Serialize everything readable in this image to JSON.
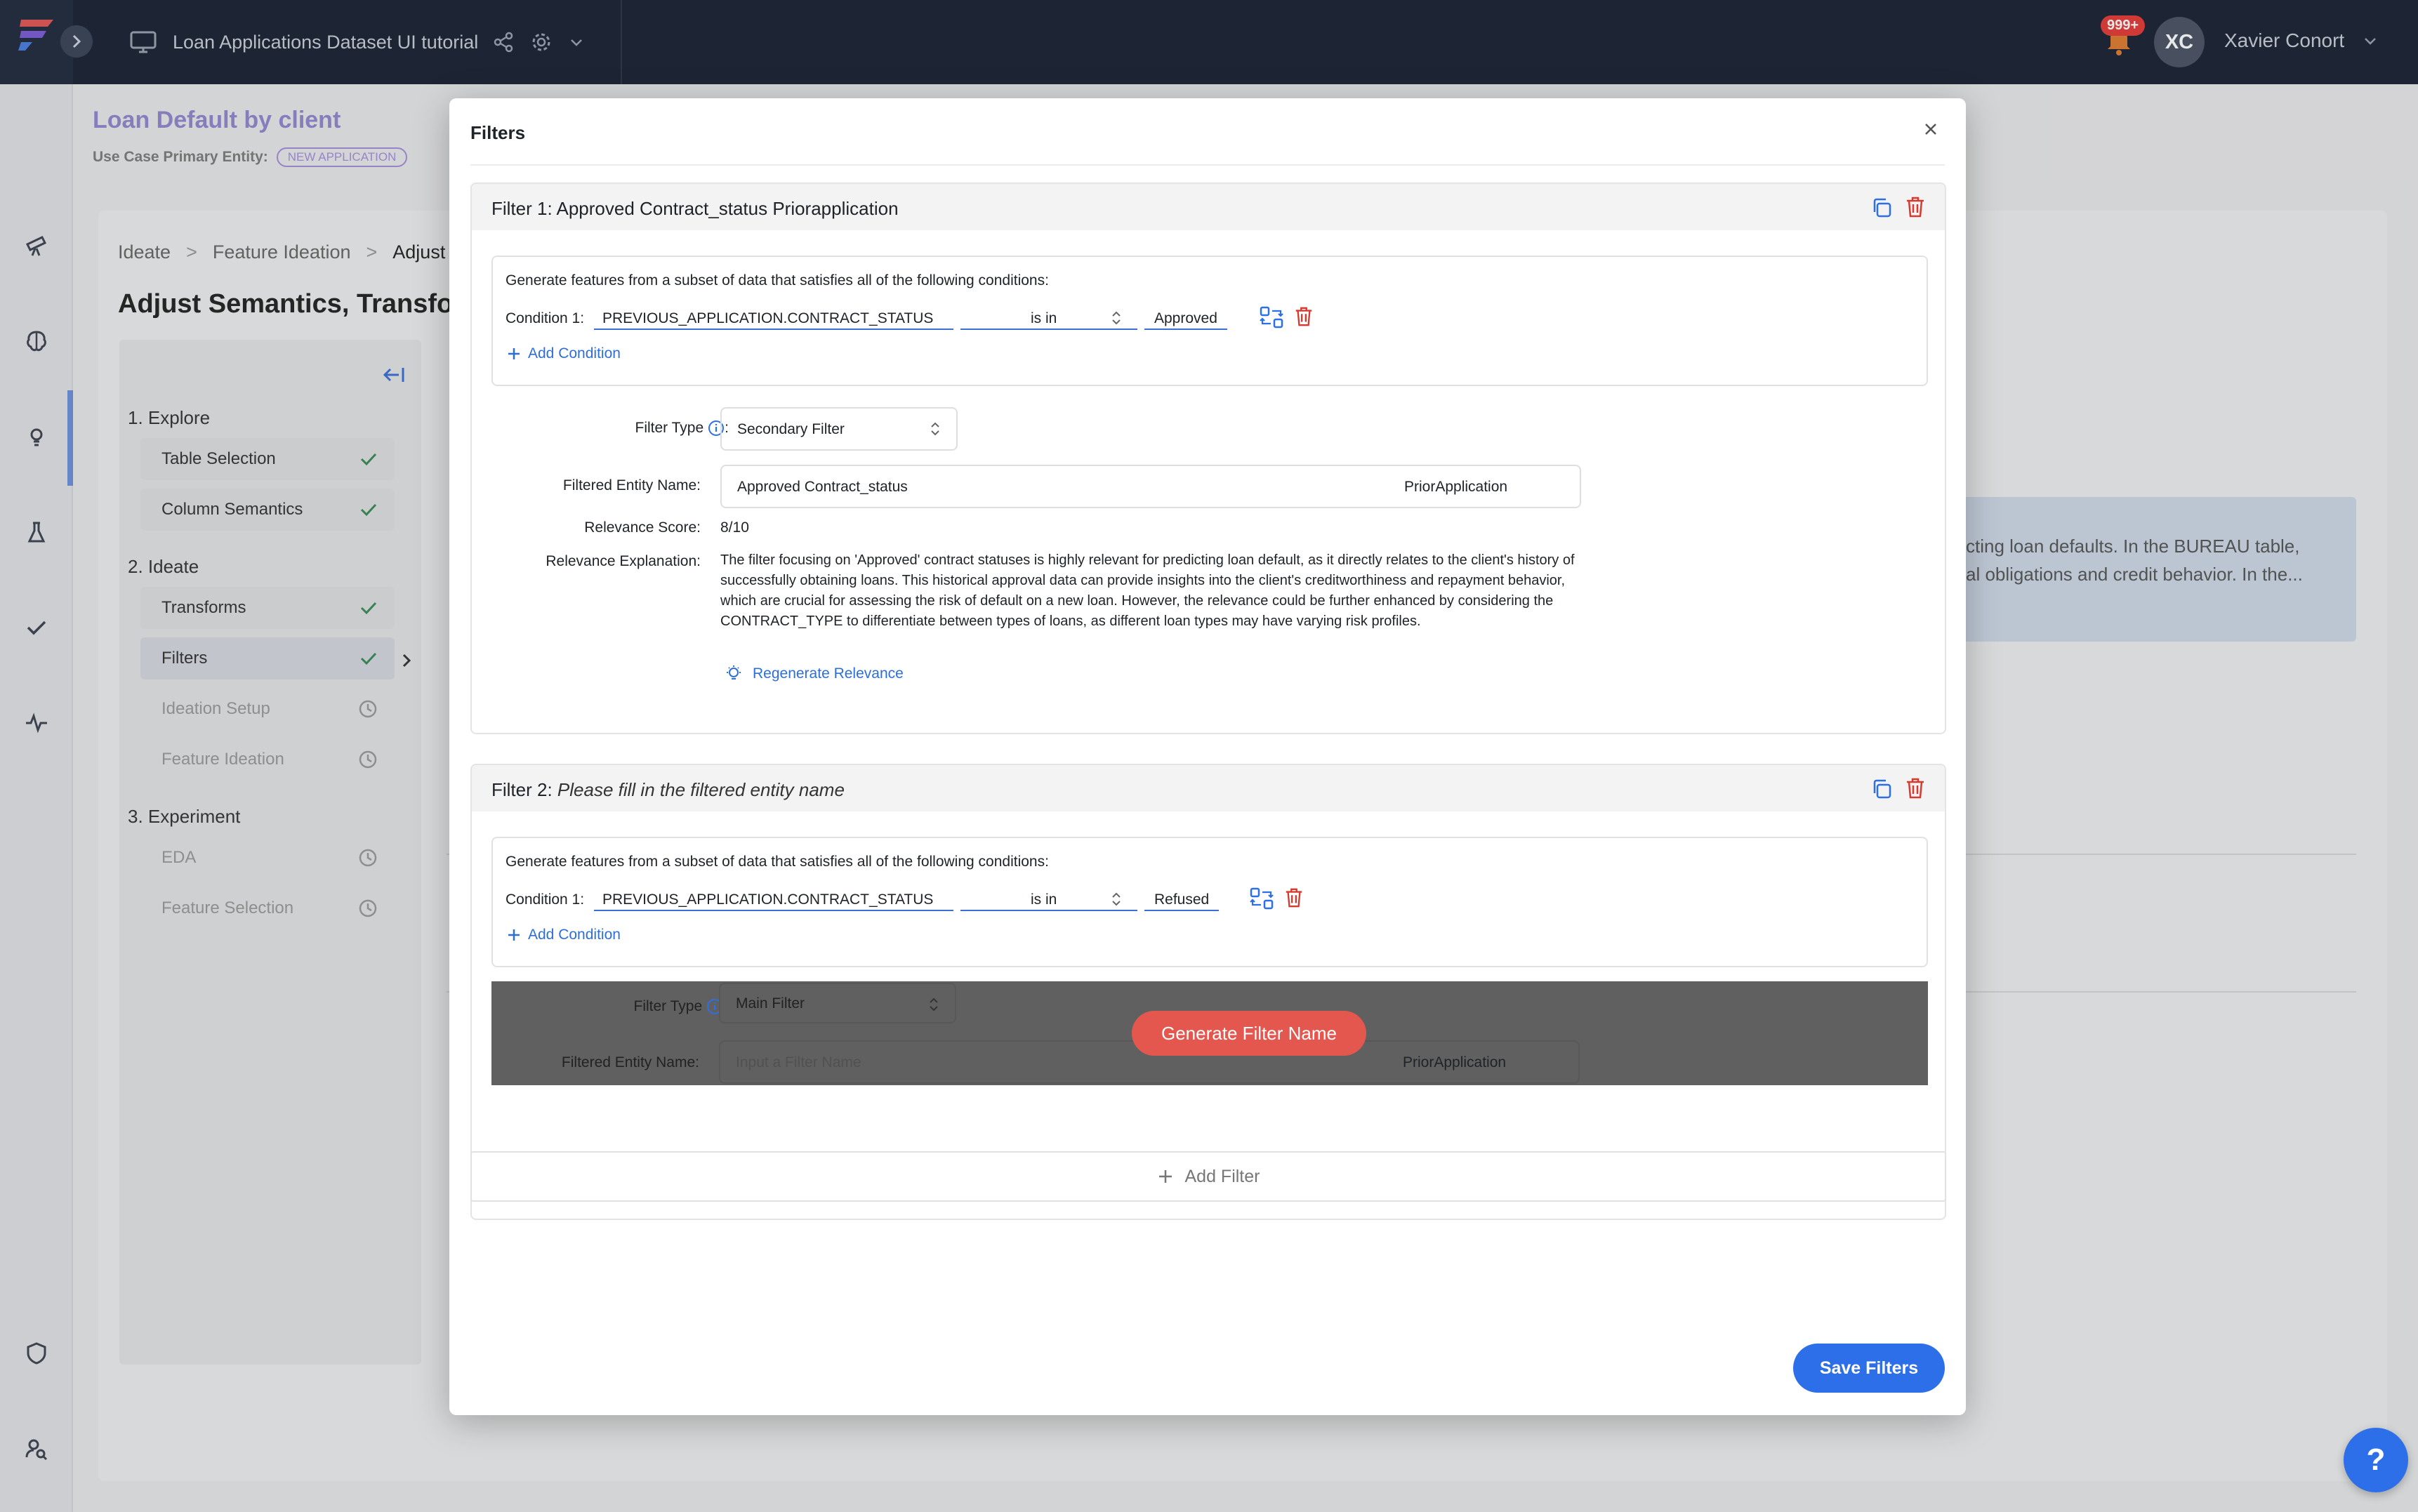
{
  "topbar": {
    "project_title": "Loan Applications Dataset UI tutorial",
    "notification_count": "999+",
    "user_initials": "XC",
    "user_name": "Xavier Conort"
  },
  "page": {
    "title": "Loan Default by client",
    "entity_label": "Use Case Primary Entity:",
    "entity_badge": "NEW APPLICATION"
  },
  "breadcrumb": [
    "Ideate",
    "Feature Ideation",
    "Adjust S"
  ],
  "section_title": "Adjust Semantics, Transfor",
  "stepper": {
    "groups": [
      "1. Explore",
      "2. Ideate",
      "3. Experiment"
    ],
    "steps": [
      {
        "label": "Table Selection",
        "status": "done"
      },
      {
        "label": "Column Semantics",
        "status": "done"
      },
      {
        "label": "Transforms",
        "status": "done"
      },
      {
        "label": "Filters",
        "status": "done"
      },
      {
        "label": "Ideation Setup",
        "status": "pending"
      },
      {
        "label": "Feature Ideation",
        "status": "pending"
      },
      {
        "label": "EDA",
        "status": "pending"
      },
      {
        "label": "Feature Selection",
        "status": "pending"
      }
    ]
  },
  "background_text": {
    "line1": "cting loan defaults. In the BUREAU table,",
    "line2": "al obligations and credit behavior. In the..."
  },
  "modal": {
    "title": "Filters",
    "filter1": {
      "prefix": "Filter 1:",
      "name": "Approved Contract_status Priorapplication",
      "lead": "Generate features from a subset of data that satisfies all of the following conditions:",
      "condition_label": "Condition 1:",
      "field": "PREVIOUS_APPLICATION.CONTRACT_STATUS",
      "operator": "is in",
      "value": "Approved",
      "add_condition": "Add Condition",
      "filter_type_label": "Filter Type",
      "filter_type": "Secondary Filter",
      "entity_name_label": "Filtered Entity Name:",
      "entity_name": "Approved Contract_status",
      "entity_table": "PriorApplication",
      "relevance_score_label": "Relevance Score:",
      "relevance_score": "8/10",
      "relevance_expl_label": "Relevance Explanation:",
      "relevance_expl": "The filter focusing on 'Approved' contract statuses is highly relevant for predicting loan default, as it directly relates to the client's history of successfully obtaining loans. This historical approval data can provide insights into the client's creditworthiness and repayment behavior, which are crucial for assessing the risk of default on a new loan. However, the relevance could be further enhanced by considering the CONTRACT_TYPE to differentiate between types of loans, as different loan types may have varying risk profiles.",
      "regenerate": "Regenerate Relevance"
    },
    "filter2": {
      "prefix": "Filter 2:",
      "name": "Please fill in the filtered entity name",
      "lead": "Generate features from a subset of data that satisfies all of the following conditions:",
      "condition_label": "Condition 1:",
      "field": "PREVIOUS_APPLICATION.CONTRACT_STATUS",
      "operator": "is in",
      "value": "Refused",
      "add_condition": "Add Condition",
      "filter_type_label": "Filter Type",
      "filter_type": "Main Filter",
      "entity_name_label": "Filtered Entity Name:",
      "entity_name_placeholder": "Input a Filter Name",
      "entity_table": "PriorApplication",
      "generate_button": "Generate Filter Name"
    },
    "add_filter": "Add Filter",
    "save_button": "Save Filters"
  },
  "help_button": "?",
  "colors": {
    "accent": "#2d6fe8",
    "danger": "#d63a2f",
    "generate": "#e4574f",
    "topbar": "#1a2233"
  }
}
